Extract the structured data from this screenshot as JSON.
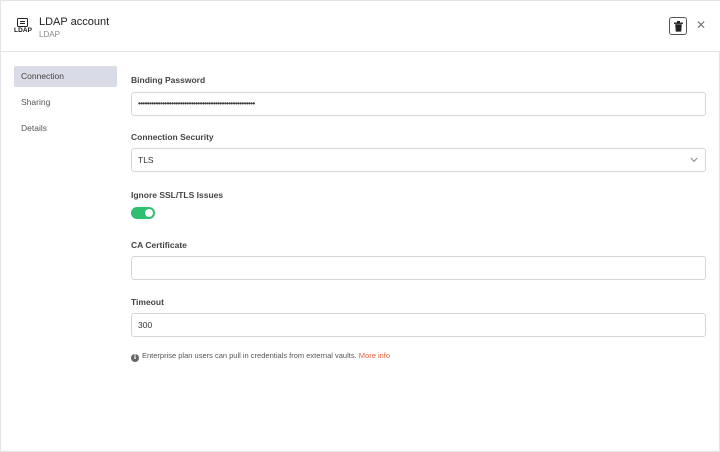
{
  "header": {
    "logo_text": "LDAP",
    "title": "LDAP account",
    "subtitle": "LDAP"
  },
  "icons": {
    "logo": "ldap-logo-icon",
    "delete": "trash-icon",
    "close": "close-icon",
    "dropdown": "chevron-down-icon",
    "info": "info-icon"
  },
  "sidebar": {
    "items": [
      {
        "label": "Connection",
        "active": true
      },
      {
        "label": "Sharing",
        "active": false
      },
      {
        "label": "Details",
        "active": false
      }
    ]
  },
  "form": {
    "binding_password": {
      "label": "Binding Password",
      "value": "•••••••••••••••••••••••••••••••••••••••••••••••••••••"
    },
    "connection_security": {
      "label": "Connection Security",
      "value": "TLS"
    },
    "ignore_ssl": {
      "label": "Ignore SSL/TLS Issues",
      "enabled": true
    },
    "ca_certificate": {
      "label": "CA Certificate",
      "value": ""
    },
    "timeout": {
      "label": "Timeout",
      "value": "300"
    }
  },
  "info": {
    "text": "Enterprise plan users can pull in credentials from external vaults.",
    "link": "More info"
  },
  "colors": {
    "toggle_on": "#2fbf71",
    "link": "#e8603c",
    "active_nav": "#d9dce6"
  }
}
